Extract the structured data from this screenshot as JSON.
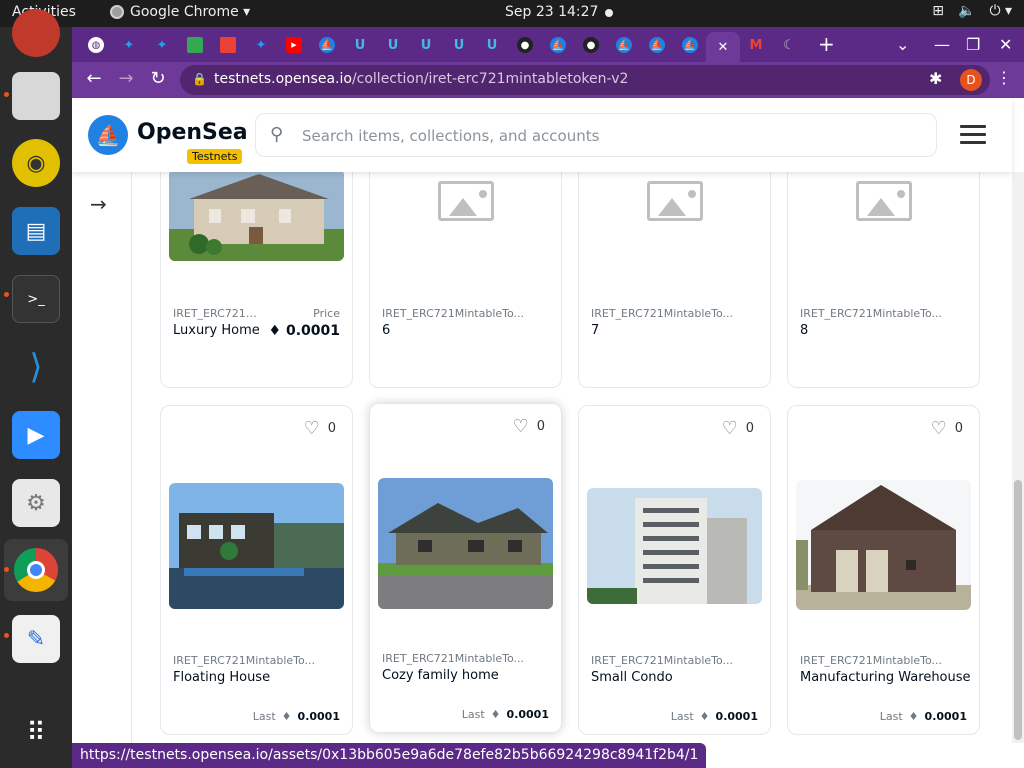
{
  "topbar": {
    "activities": "Activities",
    "app_name": "Google Chrome ▾",
    "clock": "Sep 23  14:27",
    "tray": [
      "network-icon",
      "volume-icon",
      "power-icon"
    ]
  },
  "dock": {
    "items": [
      "firefox-icon",
      "files-icon",
      "rhythmbox-icon",
      "writer-icon",
      "terminal-icon",
      "vscode-icon",
      "zoom-icon",
      "settings-icon",
      "chrome-icon",
      "text-editor-icon",
      "apps-grid-icon"
    ]
  },
  "tabs": {
    "icons": [
      "globe",
      "twitter",
      "twitter",
      "maps",
      "store",
      "twitter",
      "youtube",
      "opensea",
      "uniswap",
      "uniswap",
      "uniswap",
      "uniswap",
      "uniswap",
      "github",
      "opensea",
      "github",
      "opensea",
      "opensea",
      "opensea",
      "close",
      "gmail",
      "moon"
    ],
    "new_tab_label": "+"
  },
  "toolbar": {
    "url_host": "testnets.opensea.io",
    "url_path": "/collection/iret-erc721mintabletoken-v2",
    "avatar": "D"
  },
  "header": {
    "brand": "OpenSea",
    "badge": "Testnets",
    "search_placeholder": "Search items, collections, and accounts"
  },
  "top_row": [
    {
      "collection": "IRET_ERC721M...",
      "name": "Luxury Home",
      "price_label": "Price",
      "price": "0.0001"
    },
    {
      "collection": "IRET_ERC721MintableTo...",
      "name": "6"
    },
    {
      "collection": "IRET_ERC721MintableTo...",
      "name": "7"
    },
    {
      "collection": "IRET_ERC721MintableTo...",
      "name": "8"
    }
  ],
  "bottom_row": [
    {
      "likes": "0",
      "collection": "IRET_ERC721MintableTo...",
      "name": "Floating House",
      "last_label": "Last",
      "last": "0.0001"
    },
    {
      "likes": "0",
      "collection": "IRET_ERC721MintableTo...",
      "name": "Cozy family home",
      "last_label": "Last",
      "last": "0.0001"
    },
    {
      "likes": "0",
      "collection": "IRET_ERC721MintableTo...",
      "name": "Small Condo",
      "last_label": "Last",
      "last": "0.0001"
    },
    {
      "likes": "0",
      "collection": "IRET_ERC721MintableTo...",
      "name": "Manufacturing Warehouse",
      "last_label": "Last",
      "last": "0.0001"
    }
  ],
  "status_url": "https://testnets.opensea.io/assets/0x13bb605e9a6de78efe82b5b66924298c8941f2b4/1",
  "colors": {
    "opensea_blue": "#2081e2",
    "chrome_purple": "#6e3a99",
    "testnets_yellow": "#f6c000"
  }
}
